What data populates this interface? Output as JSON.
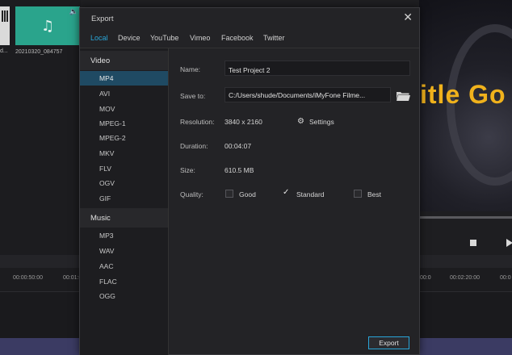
{
  "background": {
    "media": [
      {
        "label": "d...",
        "type": "video"
      },
      {
        "label": "20210320_084757",
        "type": "audio",
        "icon": "music-note-icon"
      }
    ],
    "preview_title_text": "itle Go",
    "timeline": {
      "ticks_left": [
        "00:00:50:00",
        "00:01:0"
      ],
      "ticks_right": [
        "00:0",
        "00:02:20:00",
        "00:0"
      ]
    }
  },
  "dialog": {
    "title": "Export",
    "tabs": [
      {
        "label": "Local",
        "active": true
      },
      {
        "label": "Device"
      },
      {
        "label": "YouTube"
      },
      {
        "label": "Vimeo"
      },
      {
        "label": "Facebook"
      },
      {
        "label": "Twitter"
      }
    ],
    "video_group": "Video",
    "video_formats": [
      "MP4",
      "AVI",
      "MOV",
      "MPEG-1",
      "MPEG-2",
      "MKV",
      "FLV",
      "OGV",
      "GIF"
    ],
    "selected_format": "MP4",
    "music_group": "Music",
    "music_formats": [
      "MP3",
      "WAV",
      "AAC",
      "FLAC",
      "OGG"
    ],
    "fields": {
      "name_label": "Name:",
      "name_value": "Test Project 2",
      "save_label": "Save to:",
      "save_value": "C:/Users/shude/Documents/iMyFone Filme...",
      "resolution_label": "Resolution:",
      "resolution_value": "3840 x 2160",
      "settings_label": "Settings",
      "duration_label": "Duration:",
      "duration_value": "00:04:07",
      "size_label": "Size:",
      "size_value": "610.5 MB",
      "quality_label": "Quality:",
      "quality_options": [
        "Good",
        "Standard",
        "Best"
      ],
      "quality_selected": "Standard"
    },
    "export_label": "Export"
  },
  "colors": {
    "accent": "#29a6d9",
    "selected_row": "#1f4a63",
    "dialog_bg": "#232326",
    "title_yellow": "#f0b21c",
    "media_teal": "#2aa48c"
  }
}
